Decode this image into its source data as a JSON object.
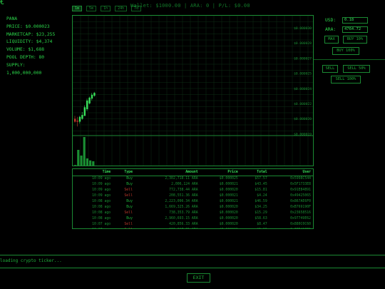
{
  "corner_glyph": "€",
  "token": {
    "name": "PANA",
    "price": "PRICE: $0.000023",
    "marketcap": "MARKETCAP: $23,255",
    "liquidity": "LIQUIDITY: $4,374",
    "volume": "VOLUME: $1,688",
    "pool_depth": "POOL DEPTH: 80",
    "supply_label": "SUPPLY:",
    "supply_value": "1,000,000,000"
  },
  "wallet_line": "Wallet: $1000.00 | ARA: 0 | P/L: $0.00",
  "timeframes": [
    {
      "label": "1m",
      "active": true
    },
    {
      "label": "5m",
      "active": false
    },
    {
      "label": "1h",
      "active": false
    },
    {
      "label": "24h",
      "active": false
    },
    {
      "label": "7d",
      "active": false
    }
  ],
  "price_axis": [
    "$0.000030",
    "$0.000028",
    "$0.000027",
    "$0.000025",
    "$0.000024",
    "$0.000022",
    "$0.000020",
    "$0.000019"
  ],
  "candles": [
    {
      "o": 2.06e-05,
      "h": 2.09e-05,
      "l": 2.02e-05,
      "c": 2.03e-05,
      "dir": "down"
    },
    {
      "o": 2.04e-05,
      "h": 2.08e-05,
      "l": 1.98e-05,
      "c": 2.03e-05,
      "dir": "down"
    },
    {
      "o": 2.03e-05,
      "h": 2.09e-05,
      "l": 2.01e-05,
      "c": 2.08e-05,
      "dir": "up"
    },
    {
      "o": 2.06e-05,
      "h": 2.13e-05,
      "l": 2.05e-05,
      "c": 2.1e-05,
      "dir": "up"
    },
    {
      "o": 2.09e-05,
      "h": 2.2e-05,
      "l": 2.09e-05,
      "c": 2.18e-05,
      "dir": "up"
    },
    {
      "o": 2.16e-05,
      "h": 2.27e-05,
      "l": 2.14e-05,
      "c": 2.25e-05,
      "dir": "up"
    },
    {
      "o": 2.22e-05,
      "h": 2.29e-05,
      "l": 2.21e-05,
      "c": 2.28e-05,
      "dir": "up"
    },
    {
      "o": 2.27e-05,
      "h": 2.33e-05,
      "l": 2.25e-05,
      "c": 2.31e-05,
      "dir": "up"
    },
    {
      "o": 2.3e-05,
      "h": 2.34e-05,
      "l": 2.29e-05,
      "c": 2.33e-05,
      "dir": "up"
    }
  ],
  "volumes": [
    0.02,
    0.55,
    0.35,
    1.0,
    0.25,
    0.18,
    0.15
  ],
  "colors": {
    "accent": "#1fae3a",
    "bright": "#37e05a",
    "sell": "#c0392b",
    "grid": "#0c2c14",
    "border": "#1b8a33"
  },
  "trade_panel": {
    "usd_label": "USD:",
    "usd_value": "0.18",
    "ara_label": "ARA:",
    "ara_value": "4764.72",
    "max_label": "MAX",
    "buy_label": "BUY 10%",
    "buy_100_label": "BUY 100%",
    "sell_label": "SELL",
    "sell_50_label": "SELL 50%",
    "sell_100_label": "SELL 100%"
  },
  "trades": {
    "headers": [
      "Time",
      "Type",
      "Amount",
      "Price",
      "Total",
      "User"
    ],
    "rows": [
      [
        "10:09 ago",
        "Buy",
        "2,302,718.11 ARA",
        "$0.000025",
        "$57.57",
        "0x5998C544"
      ],
      [
        "10:09 ago",
        "Buy",
        "2,006,124 ARA",
        "$0.000021",
        "$43.45",
        "0x5F1733E8"
      ],
      [
        "10:09 ago",
        "Sell",
        "772,738.44 ARA",
        "$0.000020",
        "$15.81",
        "0x91E84891"
      ],
      [
        "10:09 ago",
        "Sell",
        "208,551.36 ARA",
        "$0.000021",
        "$4.24",
        "0x49425065"
      ],
      [
        "10:08 ago",
        "Buy",
        "2,223,096.34 ARA",
        "$0.000021",
        "$46.59",
        "0x867AE6F0"
      ],
      [
        "10:08 ago",
        "Buy",
        "1,669,325.26 ARA",
        "$0.000020",
        "$34.25",
        "0xB769190F"
      ],
      [
        "10:08 ago",
        "Sell",
        "738,353.79 ARA",
        "$0.000020",
        "$15.29",
        "0x23658516"
      ],
      [
        "10:08 ago",
        "Buy",
        "2,960,693.15 ARA",
        "$0.000020",
        "$58.63",
        "0x97749E62"
      ],
      [
        "10:07 ago",
        "Sell",
        "420,856.33 ARA",
        "$0.000020",
        "$8.47",
        "0x880C0C60"
      ],
      [
        "10:07 ago",
        "Sell",
        "283,017.71 ARA",
        "$0.000020",
        "$5.66",
        "0x77D4C8E5"
      ]
    ]
  },
  "status_text": "loading crypto ticker...",
  "exit_label": "EXIT"
}
